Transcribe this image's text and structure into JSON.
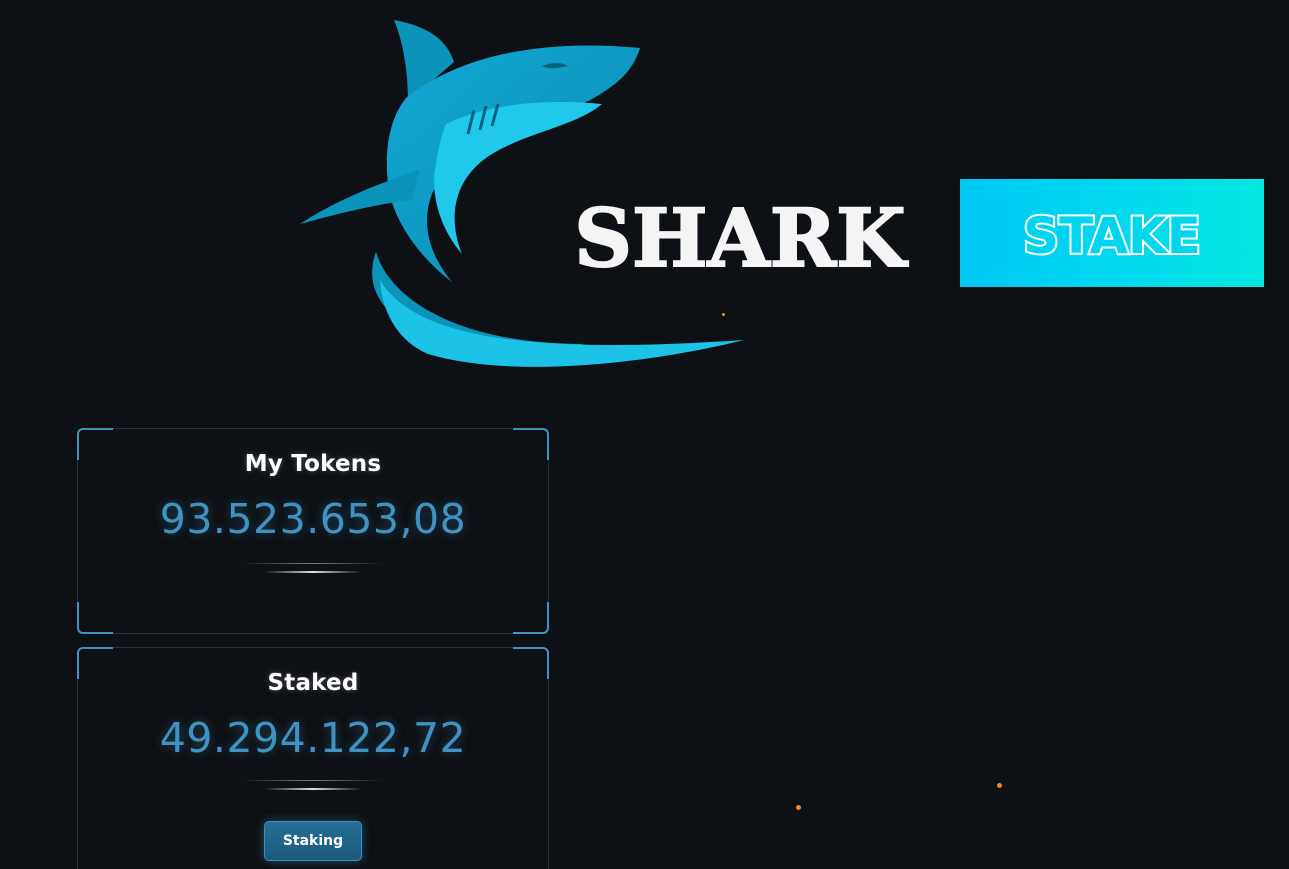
{
  "logo": {
    "word": "SHARK",
    "badge": "STAKE"
  },
  "cards": [
    {
      "title": "My Tokens",
      "value": "93.523.653,08"
    },
    {
      "title": "Staked",
      "value": "49.294.122,72",
      "button_label": "Staking"
    }
  ],
  "colors": {
    "background": "#0d1014",
    "accent": "#3f93c2",
    "shark_light": "#1cc3e6",
    "shark_dark": "#0a8bb0",
    "badge_bg": "#01d9ee",
    "particle": "#f08a24"
  },
  "icons": {
    "shark": "shark-logo-icon"
  }
}
